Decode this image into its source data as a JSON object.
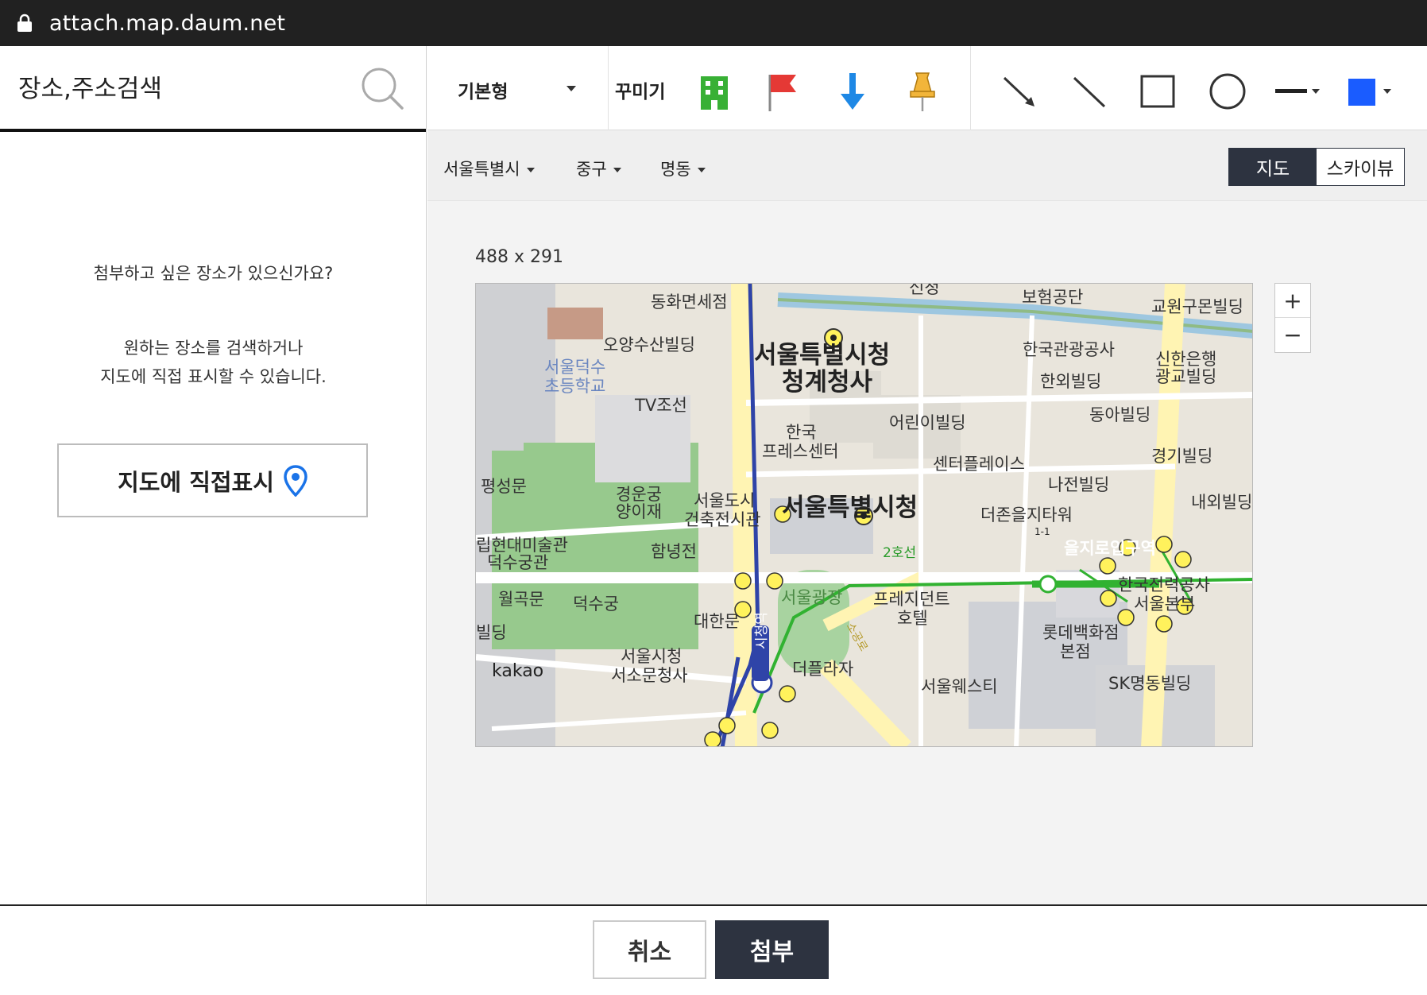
{
  "browser": {
    "url": "attach.map.daum.net"
  },
  "left_panel": {
    "search_placeholder": "장소,주소검색",
    "message_title": "첨부하고 싶은 장소가 있으신가요?",
    "message_line1": "원하는 장소를 검색하거나",
    "message_line2": "지도에 직접 표시할 수 있습니다.",
    "direct_button": "지도에 직접표시"
  },
  "toolbar": {
    "style_select": "기본형",
    "decorate_label": "꾸미기",
    "stickers": [
      "building-icon",
      "flag-icon",
      "arrow-down-icon",
      "pin-icon"
    ],
    "draw_tools": [
      "arrow-line-icon",
      "line-icon",
      "rectangle-icon",
      "circle-icon",
      "line-style-icon",
      "color-icon"
    ],
    "accent_color": "#1a5cff"
  },
  "regions": {
    "city": "서울특별시",
    "district": "중구",
    "dong": "명동"
  },
  "view_toggle": {
    "map": "지도",
    "skyview": "스카이뷰",
    "selected": "지도"
  },
  "map": {
    "size_label": "488 x 291",
    "zoom_in": "+",
    "zoom_out": "−",
    "labels": {
      "l1": "동화면세점",
      "l2": "보험공단",
      "l3": "교원구몬빌딩",
      "l4": "오양수산빌딩",
      "l5": "서울덕수",
      "l6": "초등학교",
      "l7": "TV조선",
      "l8": "서울특별시청",
      "l9": "청계청사",
      "l10": "한국관광공사",
      "l11": "신한은행",
      "l12": "광교빌딩",
      "l13": "한외빌딩",
      "l14": "어린이빌딩",
      "l15": "동아빌딩",
      "l16": "한국",
      "l17": "프레스센터",
      "l18": "센터플레이스",
      "l19": "경기빌딩",
      "l20": "평성문",
      "l21": "경운궁",
      "l22": "양이재",
      "l23": "서울도시",
      "l24": "건축전시관",
      "l25": "서울특별시청",
      "l26": "나전빌딩",
      "l27": "내외빌딩",
      "l28": "더존을지타워",
      "l29": "립현대미술관",
      "l30": "덕수궁관",
      "l31": "함녕전",
      "l32": "2호선",
      "l33": "을지로입구역",
      "l34": "월곡문",
      "l35": "덕수궁",
      "l36": "서울광장",
      "l37": "프레지던트",
      "l38": "호텔",
      "l39": "한국전력공사",
      "l40": "서울본부",
      "l41": "대한문",
      "l42": "시청역",
      "l43": "빌딩",
      "l44": "롯데백화점",
      "l45": "본점",
      "l46": "서울시청",
      "l47": "서소문청사",
      "l48": "더플라자",
      "l49": "SK명동빌딩",
      "l50": "kakao",
      "l51": "서울웨스티",
      "l52": "신청",
      "l53": "소공로",
      "l54": "1-1"
    }
  },
  "footer": {
    "cancel": "취소",
    "attach": "첨부"
  }
}
